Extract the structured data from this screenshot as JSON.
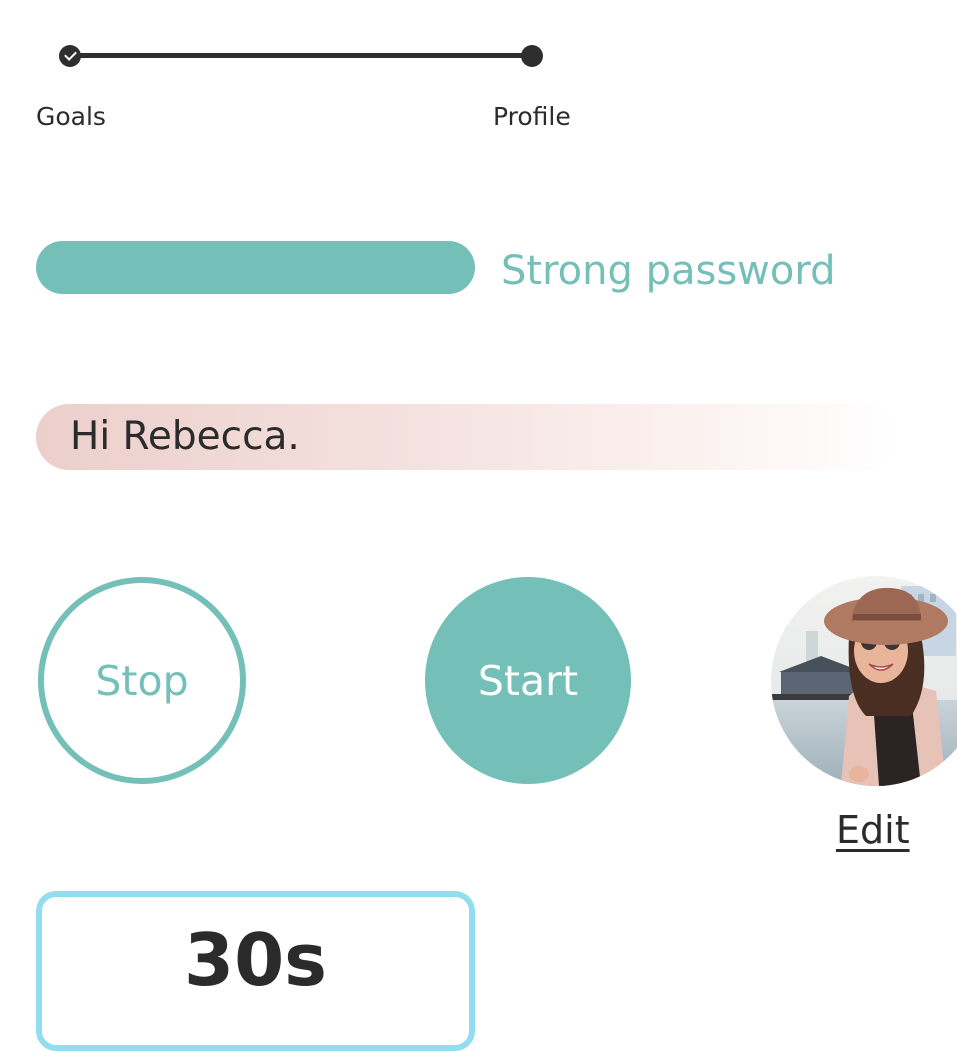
{
  "stepper": {
    "steps": [
      {
        "label": "Goals",
        "completed": true
      },
      {
        "label": "Profile",
        "completed": false
      }
    ]
  },
  "password_strength": {
    "label": "Strong password",
    "level": 1.0,
    "color": "#74bfb7"
  },
  "greeting": {
    "text": "Hi Rebecca."
  },
  "controls": {
    "stop_label": "Stop",
    "start_label": "Start",
    "accent_color": "#74bfb7"
  },
  "profile": {
    "avatar": "woman-with-hat-photo",
    "edit_label": "Edit"
  },
  "timer": {
    "value": "30s",
    "border_color": "#92def0"
  }
}
